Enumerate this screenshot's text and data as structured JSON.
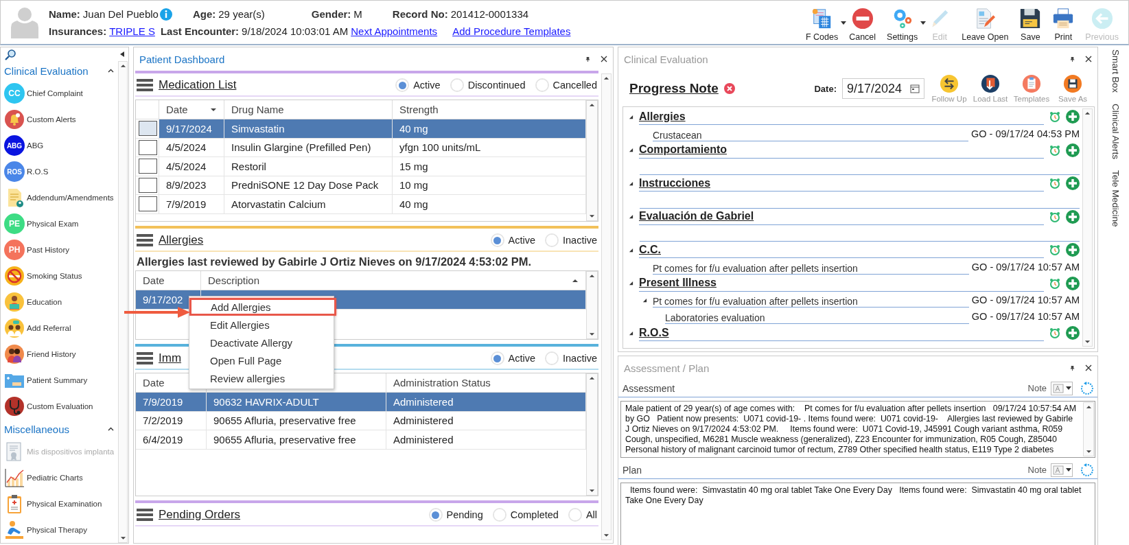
{
  "header": {
    "name_label": "Name:",
    "name": "Juan Del Pueblo",
    "age_label": "Age:",
    "age": "29 year(s)",
    "gender_label": "Gender:",
    "gender": "M",
    "record_label": "Record No:",
    "record": "201412-0001334",
    "insurances_label": "Insurances:",
    "insurance": "TRIPLE S",
    "last_encounter_label": "Last Encounter:",
    "last_encounter": "9/18/2024 10:03:01 AM",
    "links": [
      "Next Appointments",
      "Add Procedure Templates"
    ]
  },
  "toolbar": [
    {
      "label": "F Codes",
      "kind": "calculator",
      "dropdown": true,
      "disabled": false
    },
    {
      "label": "Cancel",
      "kind": "cancel",
      "dropdown": false,
      "disabled": false
    },
    {
      "label": "Settings",
      "kind": "gears",
      "dropdown": true,
      "disabled": false
    },
    {
      "label": "Edit",
      "kind": "pencil",
      "dropdown": false,
      "disabled": true
    },
    {
      "label": "Leave Open",
      "kind": "document",
      "dropdown": false,
      "disabled": false
    },
    {
      "label": "Save",
      "kind": "floppy",
      "dropdown": false,
      "disabled": false
    },
    {
      "label": "Print",
      "kind": "printer",
      "dropdown": false,
      "disabled": false
    },
    {
      "label": "Previous",
      "kind": "back",
      "dropdown": false,
      "disabled": true
    }
  ],
  "sidebar": {
    "sections": [
      {
        "title": "Clinical Evaluation",
        "expanded": true,
        "items": [
          {
            "label": "Chief Complaint",
            "kind": "initials",
            "badge": "CC",
            "color": "#2ec5f0",
            "disabled": false
          },
          {
            "label": "Custom Alerts",
            "kind": "bell",
            "disabled": false
          },
          {
            "label": "ABG",
            "kind": "initials",
            "badge": "ABG",
            "color": "#0a14e0",
            "disabled": false
          },
          {
            "label": "R.O.S",
            "kind": "initials",
            "badge": "ROS",
            "color": "#4a86e8",
            "disabled": false
          },
          {
            "label": "Addendum/Amendments",
            "kind": "document",
            "disabled": false
          },
          {
            "label": "Physical Exam",
            "kind": "initials",
            "badge": "PE",
            "color": "#3ddc84",
            "disabled": false
          },
          {
            "label": "Past History",
            "kind": "initials",
            "badge": "PH",
            "color": "#f4735c",
            "disabled": false
          },
          {
            "label": "Smoking Status",
            "kind": "nosmoking",
            "disabled": false
          },
          {
            "label": "Education",
            "kind": "reader",
            "disabled": false
          },
          {
            "label": "Add Referral",
            "kind": "referral",
            "disabled": false
          },
          {
            "label": "Friend History",
            "kind": "family",
            "disabled": false
          },
          {
            "label": "Patient Summary",
            "kind": "folder",
            "disabled": false
          },
          {
            "label": "Custom Evaluation",
            "kind": "stethoscope",
            "disabled": false
          }
        ]
      },
      {
        "title": "Miscellaneous",
        "expanded": true,
        "items": [
          {
            "label": "Mis dispositivos implanta",
            "kind": "certificate",
            "disabled": true
          },
          {
            "label": "Pediatric Charts",
            "kind": "chart",
            "disabled": false
          },
          {
            "label": "Physical Examination",
            "kind": "clipboard",
            "disabled": false
          },
          {
            "label": "Physical Therapy",
            "kind": "therapy",
            "disabled": false
          }
        ]
      }
    ]
  },
  "dashboard": {
    "title": "Patient Dashboard",
    "sections": [
      {
        "kind": "medication",
        "title": "Medication List",
        "color": "#c8a6ea",
        "filters": [
          {
            "label": "Active",
            "selected": true
          },
          {
            "label": "Discontinued",
            "selected": false
          },
          {
            "label": "Cancelled",
            "selected": false
          }
        ],
        "table": {
          "columns": [
            {
              "label": "Date",
              "sort_ascending": false
            },
            {
              "label": "Drug Name"
            },
            {
              "label": "Strength"
            }
          ],
          "rows": [
            {
              "checked": false,
              "selected": true,
              "cells": [
                "9/17/2024",
                "Simvastatin",
                "40 mg"
              ]
            },
            {
              "checked": false,
              "selected": false,
              "cells": [
                "4/5/2024",
                "Insulin Glargine (Prefilled Pen)",
                "yfgn 100 units/mL"
              ]
            },
            {
              "checked": false,
              "selected": false,
              "cells": [
                "4/5/2024",
                "Restoril",
                "15 mg"
              ]
            },
            {
              "checked": false,
              "selected": false,
              "cells": [
                "8/9/2023",
                "PredniSONE 12 Day Dose Pack",
                "10 mg"
              ]
            },
            {
              "checked": false,
              "selected": false,
              "cells": [
                "7/9/2019",
                "Atorvastatin Calcium",
                "40 mg"
              ]
            }
          ]
        }
      },
      {
        "kind": "allergies",
        "title": "Allergies",
        "color": "#f2c15a",
        "filters": [
          {
            "label": "Active",
            "selected": true
          },
          {
            "label": "Inactive",
            "selected": false
          }
        ],
        "note": "Allergies last reviewed by Gabirle J Ortiz Nieves on 9/17/2024 4:53:02 PM.",
        "table": {
          "columns": [
            {
              "label": "Date"
            },
            {
              "label": "Description",
              "sort_ascending": true
            }
          ],
          "rows": [
            {
              "selected": true,
              "cells": [
                "9/17/202"
              ]
            }
          ]
        },
        "menu": [
          {
            "label": "Add Allergies",
            "highlighted": true
          },
          {
            "label": "Edit Allergies",
            "highlighted": false
          },
          {
            "label": "Deactivate Allergy",
            "highlighted": false
          },
          {
            "label": "Open Full Page",
            "highlighted": false
          },
          {
            "label": "Review allergies",
            "highlighted": false
          }
        ]
      },
      {
        "kind": "immunizations",
        "title": "Imm",
        "color": "#58b2dc",
        "filters": [
          {
            "label": "Active",
            "selected": true
          },
          {
            "label": "Inactive",
            "selected": false
          }
        ],
        "table": {
          "columns": [
            {
              "label": "Date"
            },
            {},
            {
              "label": "Administration Status"
            }
          ],
          "rows": [
            {
              "selected": true,
              "cells": [
                "7/9/2019",
                "90632 HAVRIX-ADULT",
                "Administered"
              ]
            },
            {
              "selected": false,
              "cells": [
                "7/2/2019",
                "90655 Afluria, preservative free",
                "Administered"
              ]
            },
            {
              "selected": false,
              "cells": [
                "6/4/2019",
                "90655 Afluria, preservative free",
                "Administered"
              ]
            }
          ]
        }
      },
      {
        "kind": "pending",
        "title": "Pending Orders",
        "color": "#c8a6ea",
        "filters": [
          {
            "label": "Pending",
            "selected": true
          },
          {
            "label": "Completed",
            "selected": false
          },
          {
            "label": "All",
            "selected": false
          }
        ]
      }
    ]
  },
  "evaluation": {
    "title": "Clinical Evaluation",
    "note_title": "Progress Note",
    "date_label": "Date:",
    "date": "9/17/2024",
    "actions": [
      {
        "label": "Follow Up",
        "kind": "swap"
      },
      {
        "label": "Load Last",
        "kind": "download"
      },
      {
        "label": "Templates",
        "kind": "clipboard"
      },
      {
        "label": "Save As",
        "kind": "floppy"
      }
    ],
    "sections": [
      {
        "title": "Allergies",
        "expanded": true,
        "entries": [
          {
            "text": "Crustacean",
            "stamp": "GO - 09/17/24 04:53 PM"
          }
        ]
      },
      {
        "title": "Comportamiento",
        "expanded": true
      },
      {
        "title": "Instrucciones",
        "expanded": true
      },
      {
        "title": "Evaluación de Gabriel",
        "expanded": true
      },
      {
        "title": "C.C.",
        "expanded": true,
        "entries": [
          {
            "text": "Pt comes for f/u evaluation after pellets insertion",
            "stamp": "GO - 09/17/24 10:57 AM"
          }
        ]
      },
      {
        "title": "Present Illness",
        "expanded": true,
        "entries": [
          {
            "text": "Pt comes for f/u evaluation after pellets insertion",
            "stamp": "GO - 09/17/24 10:57 AM",
            "expanded": true,
            "children": [
              {
                "text": "Laboratories evaluation",
                "stamp": "GO - 09/17/24 10:57 AM"
              }
            ]
          }
        ]
      },
      {
        "title": "R.O.S",
        "expanded": true
      }
    ]
  },
  "assessment_plan": {
    "title": "Assessment / Plan",
    "fields": [
      {
        "label": "Assessment",
        "note_label": "Note",
        "text": "Male patient of 29 year(s) of age comes with:    Pt comes for f/u evaluation after pellets insertion   09/17/24 10:57:54 AM by GO   Patient now presents:  U071 covid-19- . Items found were:  U071 covid-19-    Allergies last reviewed by Gabirle J Ortiz Nieves on 9/17/2024 4:53:02 PM.     Items found were:  U071 Covid-19, J45991 Cough variant asthma, R059 Cough, unspecified, M6281 Muscle weakness (generalized), Z23 Encounter for immunization, R05 Cough, Z85040 Personal history of malignant carcinoid tumor of rectum, Z789 Other specified health status, E119 Type 2 diabetes"
      },
      {
        "label": "Plan",
        "note_label": "Note",
        "text": "  Items found were:  Simvastatin 40 mg oral tablet Take One Every Day   Items found were:  Simvastatin 40 mg oral tablet Take One Every Day"
      }
    ]
  },
  "side_tabs": [
    "Smart Box",
    "Clinical Alerts",
    "Tele Medicine"
  ]
}
